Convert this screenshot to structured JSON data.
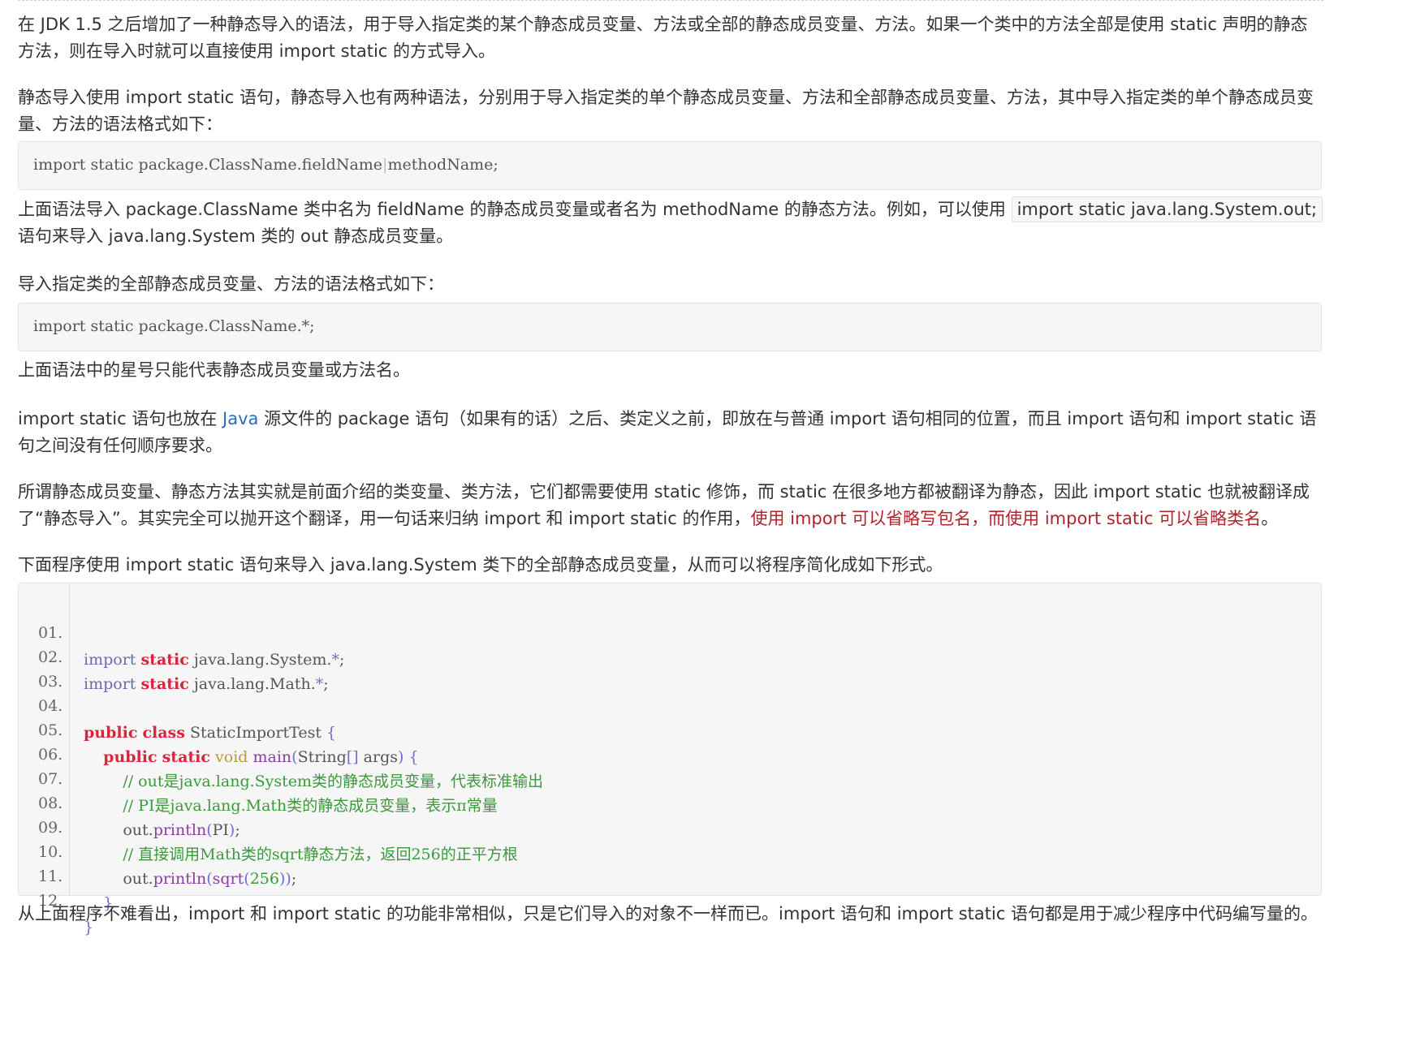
{
  "paragraphs": {
    "p1": "在 JDK 1.5 之后增加了一种静态导入的语法，用于导入指定类的某个静态成员变量、方法或全部的静态成员变量、方法。如果一个类中的方法全部是使用 static 声明的静态方法，则在导入时就可以直接使用 import static 的方式导入。",
    "p2": "静态导入使用 import static 语句，静态导入也有两种语法，分别用于导入指定类的单个静态成员变量、方法和全部静态成员变量、方法，其中导入指定类的单个静态成员变量、方法的语法格式如下：",
    "p3_before": "上面语法导入 package.ClassName 类中名为 fieldName 的静态成员变量或者名为 methodName 的静态方法。例如，可以使用 ",
    "p3_code": "import static java.lang.System.out;",
    "p3_after": " 语句来导入 java.lang.System 类的 out 静态成员变量。",
    "p4": "导入指定类的全部静态成员变量、方法的语法格式如下：",
    "p5": "上面语法中的星号只能代表静态成员变量或方法名。",
    "p6_before": "import static 语句也放在 ",
    "p6_link": "Java",
    "p6_after": " 源文件的 package 语句（如果有的话）之后、类定义之前，即放在与普通 import 语句相同的位置，而且 import 语句和 import static 语句之间没有任何顺序要求。",
    "p7_before": "所谓静态成员变量、静态方法其实就是前面介绍的类变量、类方法，它们都需要使用 static 修饰，而 static 在很多地方都被翻译为静态，因此 import static 也就被翻译成了“静态导入”。其实完全可以抛开这个翻译，用一句话来归纳 import 和 import static 的作用，",
    "p7_highlight": "使用 import 可以省略写包名，而使用 import static 可以省略类名",
    "p7_after": "。",
    "p8": "下面程序使用 import static 语句来导入 java.lang.System 类下的全部静态成员变量，从而可以将程序简化成如下形式。",
    "p9": "从上面程序不难看出，import 和 import static 的功能非常相似，只是它们导入的对象不一样而已。import 语句和 import static 语句都是用于减少程序中代码编写量的。"
  },
  "syntax1": {
    "part1": "import static package.ClassName.fieldName",
    "sep": "|",
    "part2": "methodName;"
  },
  "syntax2": "import static package.ClassName.*;",
  "program": {
    "line_numbers": [
      "01.",
      "02.",
      "03.",
      "04.",
      "05.",
      "06.",
      "07.",
      "08.",
      "09.",
      "10.",
      "11.",
      "12."
    ],
    "l1": {
      "a": "import",
      "b": "static",
      "c": "java.lang.System.",
      "d": "*",
      "e": ";"
    },
    "l2": {
      "a": "import",
      "b": "static",
      "c": "java.lang.Math.",
      "d": "*",
      "e": ";"
    },
    "l4": {
      "a": "public",
      "b": "class",
      "c": "StaticImportTest",
      "d": "{"
    },
    "l5": {
      "a": "public",
      "b": "static",
      "c": "void",
      "d": "main",
      "e": "(",
      "f": "String",
      "g": "[]",
      "h": "args",
      "i": ")",
      "j": "{"
    },
    "l6": "// out是java.lang.System类的静态成员变量，代表标准输出",
    "l7": "// PI是java.lang.Math类的静态成员变量，表示π常量",
    "l8": {
      "a": "out.",
      "b": "println",
      "c": "(",
      "d": "PI",
      "e": ")",
      "f": ";"
    },
    "l9": "// 直接调用Math类的sqrt静态方法，返回256的正平方根",
    "l10": {
      "a": "out.",
      "b": "println",
      "c": "(",
      "d": "sqrt",
      "e": "(",
      "f": "256",
      "g": "))",
      "h": ";"
    },
    "l11": "}",
    "l12": "}"
  }
}
